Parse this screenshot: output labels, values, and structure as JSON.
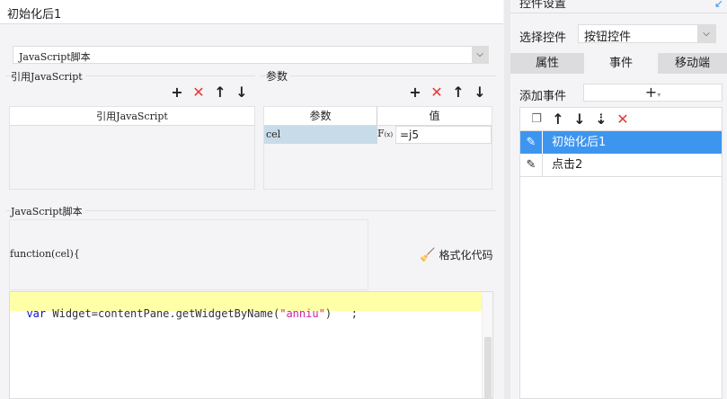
{
  "left": {
    "title": "初始化后1",
    "type_select": "JavaScript脚本",
    "ref_section": "引用JavaScript",
    "ref_col": "引用JavaScript",
    "param_section": "参数",
    "param_cols": [
      "参数",
      "值"
    ],
    "params": [
      {
        "name": "cel",
        "value": "=j5"
      }
    ],
    "script_section": "JavaScript脚本",
    "function_sig": "function(cel){",
    "format_btn": "格式化代码",
    "code": {
      "kw": "var",
      "pre": " Widget=contentPane.getWidgetByName(",
      "str": "\"anniu\"",
      "post": ")   ;"
    }
  },
  "right": {
    "title": "控件设置",
    "select_label": "选择控件",
    "select_value": "按钮控件",
    "tabs": [
      "属性",
      "事件",
      "移动端"
    ],
    "active_tab": 1,
    "add_event_label": "添加事件",
    "events": [
      {
        "label": "初始化后1",
        "selected": true
      },
      {
        "label": "点击2",
        "selected": false
      }
    ]
  }
}
